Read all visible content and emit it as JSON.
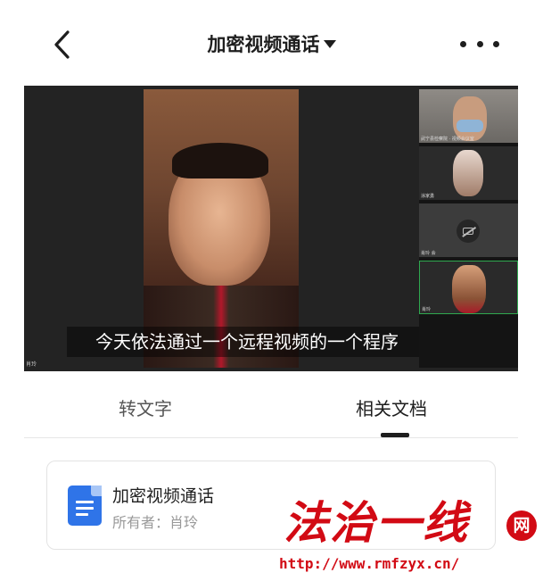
{
  "header": {
    "title": "加密视频通话"
  },
  "video": {
    "subtitle": "今天依法通过一个远程视频的一个程序",
    "main_label": "肖玲",
    "thumbnails": [
      {
        "label": "武宁县检察院 · 视频会议室"
      },
      {
        "label": "涂家勇"
      },
      {
        "label": "肖玲 会"
      },
      {
        "label": "肖玲"
      }
    ]
  },
  "tabs": [
    {
      "label": "转文字"
    },
    {
      "label": "相关文档"
    }
  ],
  "active_tab": 1,
  "document": {
    "name": "加密视频通话",
    "owner": "所有者：肖玲",
    "icon": "doc-icon",
    "icon_color": "#2f74e8"
  },
  "watermark": {
    "logo_text": "法治一线",
    "badge": "网",
    "url": "http://www.rmfzyx.cn/",
    "color": "#d20a14"
  }
}
